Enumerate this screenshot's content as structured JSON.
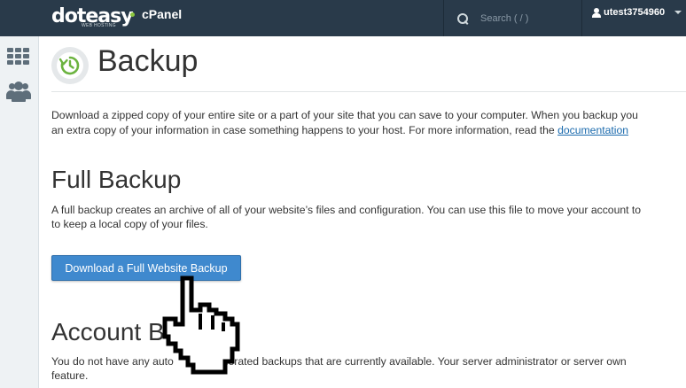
{
  "header": {
    "logo_text": "doteasy",
    "logo_tagline": "WEB HOSTING",
    "product_label": "cPanel",
    "search": {
      "placeholder": "Search ( / )"
    },
    "user": {
      "username": "utest3754960"
    },
    "colors": {
      "topbar": "#293a4a",
      "logo_accent": "#8cc63f"
    }
  },
  "sidebar": {
    "items": [
      {
        "name": "home-grid",
        "icon": "grid-icon"
      },
      {
        "name": "users",
        "icon": "users-icon"
      }
    ]
  },
  "page": {
    "title": "Backup",
    "intro": {
      "line1": "Download a zipped copy of your entire site or a part of your site that you can save to your computer. When you backup you",
      "line2_text": "an extra copy of your information in case something happens to your host. For more information, read the ",
      "link": "documentation"
    },
    "full_backup": {
      "heading": "Full Backup",
      "line1": "A full backup creates an archive of all of your website’s files and configuration. You can use this file to move your account to",
      "line2": "to keep a local copy of your files.",
      "button": "Download a Full Website Backup",
      "button_color": "#3f89ce"
    },
    "account_backups": {
      "heading": "Account Ba",
      "line1_a": "You do not have any auto",
      "line1_b": " generated backups that are currently available. Your server administrator or server own",
      "line2": "feature."
    }
  },
  "overlay": {
    "cursor": "hand-pointer-icon"
  }
}
